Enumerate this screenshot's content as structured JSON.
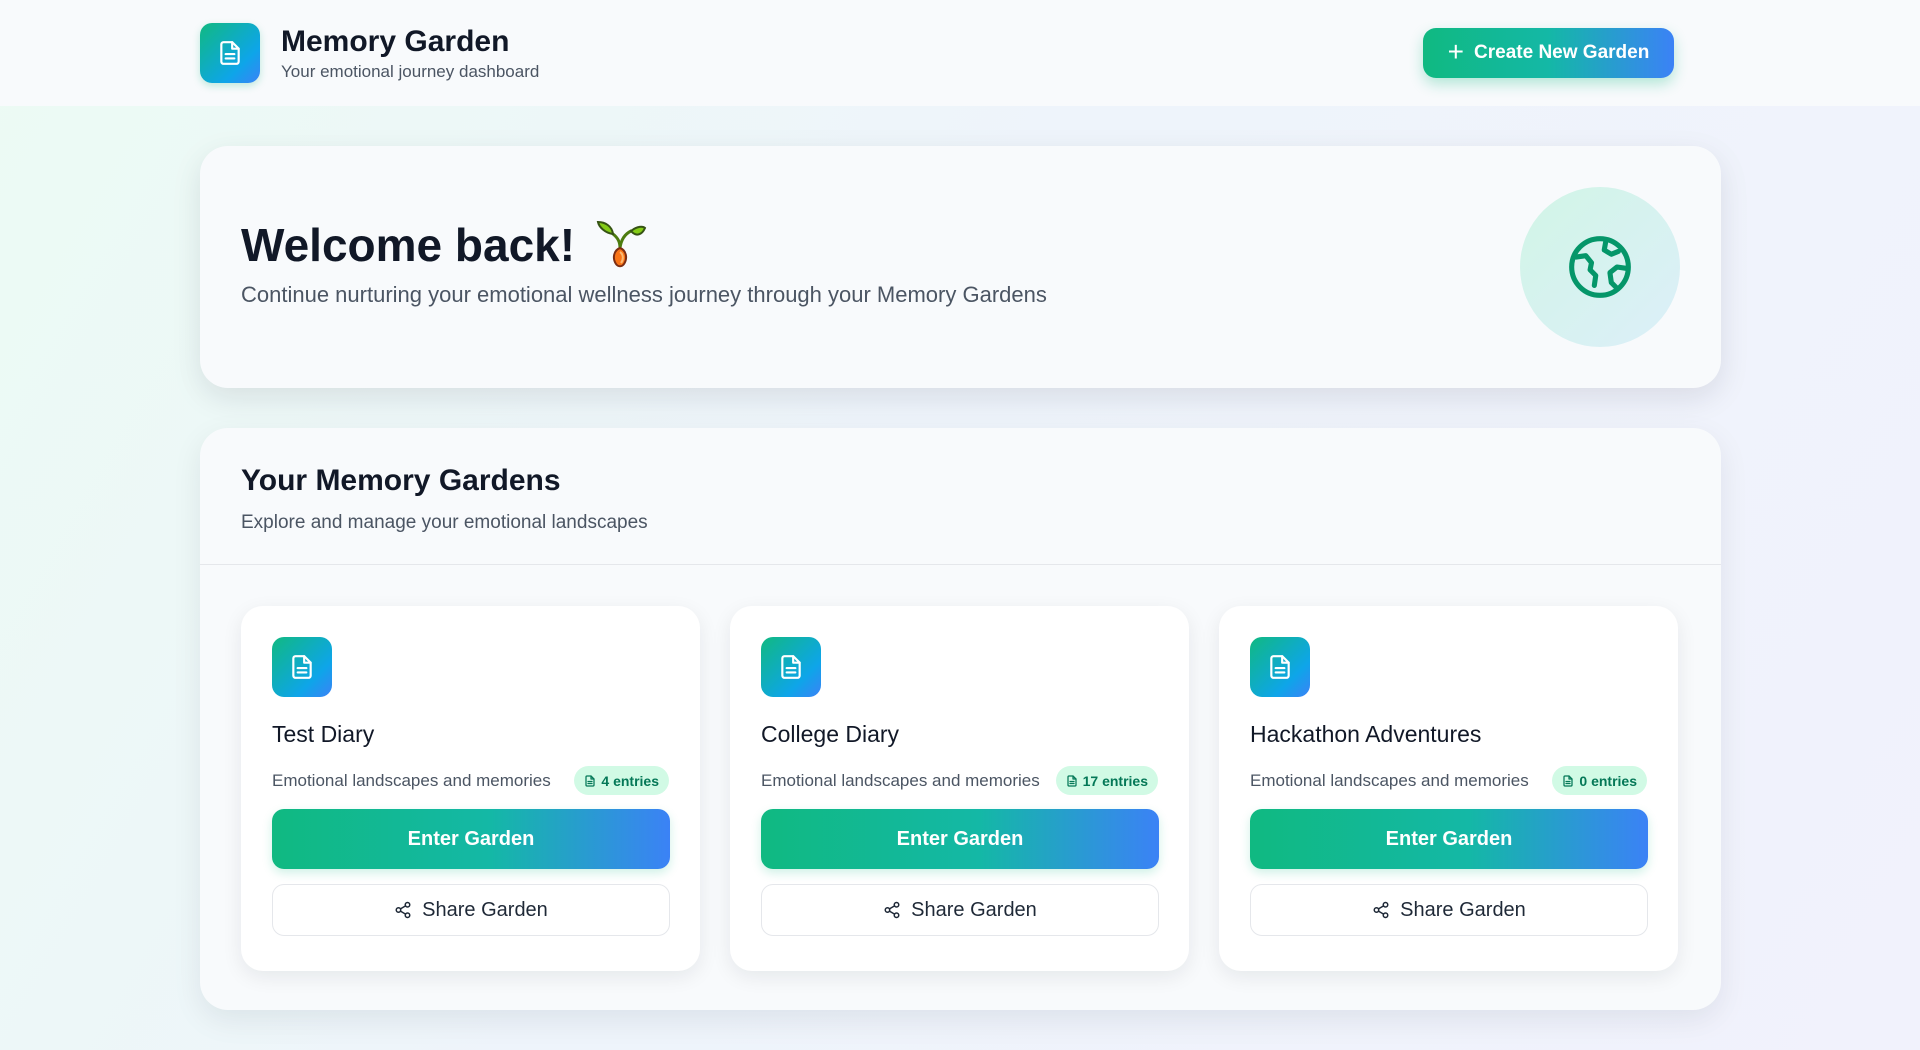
{
  "header": {
    "app_title": "Memory Garden",
    "app_subtitle": "Your emotional journey dashboard",
    "logo_icon": "document-icon",
    "create_button": {
      "label": "Create New Garden",
      "icon": "plus-icon"
    }
  },
  "welcome": {
    "title": "Welcome back!",
    "title_icon": "seedling-icon",
    "subtitle": "Continue nurturing your emotional wellness journey through your Memory Gardens",
    "decor_icon": "globe-icon"
  },
  "gardens": {
    "title": "Your Memory Gardens",
    "subtitle": "Explore and manage your emotional landscapes",
    "items": [
      {
        "name": "Test Diary",
        "description": "Emotional landscapes and memories",
        "entries": "4 entries",
        "enter_label": "Enter Garden",
        "share_label": "Share Garden"
      },
      {
        "name": "College Diary",
        "description": "Emotional landscapes and memories",
        "entries": "17 entries",
        "enter_label": "Enter Garden",
        "share_label": "Share Garden"
      },
      {
        "name": "Hackathon Adventures",
        "description": "Emotional landscapes and memories",
        "entries": "0 entries",
        "enter_label": "Enter Garden",
        "share_label": "Share Garden"
      }
    ]
  },
  "colors": {
    "accent_green": "#10b981",
    "accent_blue": "#3b82f6",
    "badge_bg": "#d1fae5",
    "badge_text": "#047857"
  }
}
